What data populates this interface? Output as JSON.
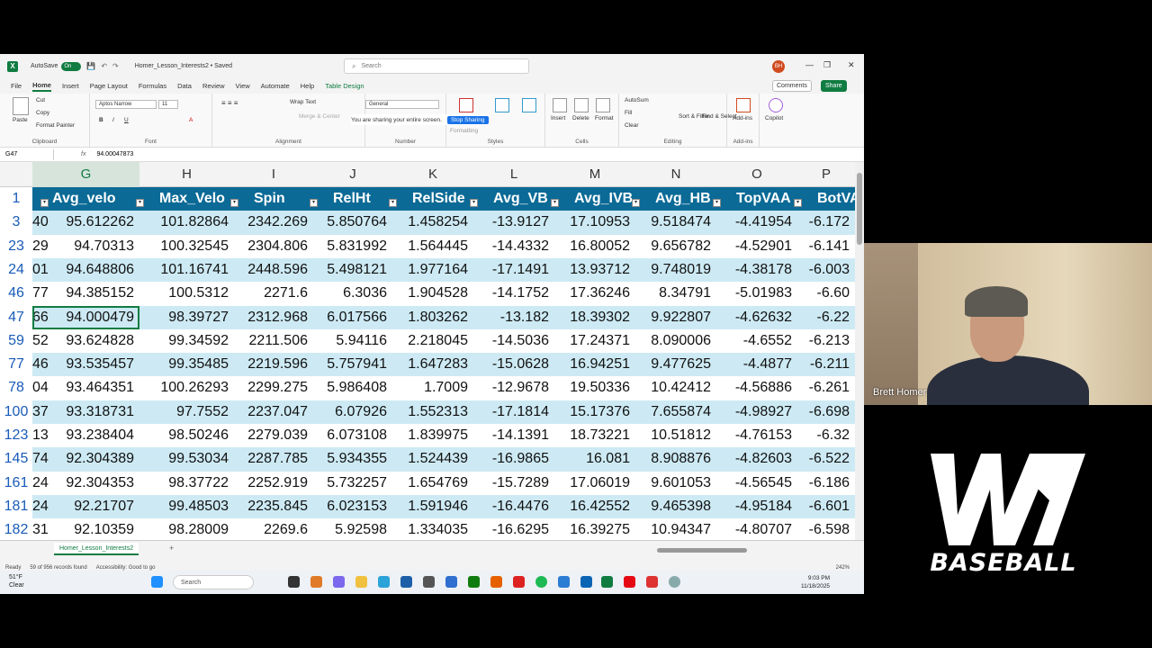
{
  "excel": {
    "autosave_label": "AutoSave",
    "autosave_state": "On",
    "doc_title": "Homer_Lesson_Interests2 • Saved",
    "search_placeholder": "Search",
    "avatar_initials": "BH",
    "tabs": [
      "File",
      "Home",
      "Insert",
      "Page Layout",
      "Formulas",
      "Data",
      "Review",
      "View",
      "Automate",
      "Help",
      "Table Design"
    ],
    "comments_label": "Comments",
    "share_label": "Share",
    "ribbon": {
      "paste": "Paste",
      "cut": "Cut",
      "copy": "Copy",
      "format_painter": "Format Painter",
      "clipboard": "Clipboard",
      "font_name": "Aptos Narrow",
      "font_size": "11",
      "font": "Font",
      "wrap_text": "Wrap Text",
      "merge_center": "Merge & Center",
      "alignment": "Alignment",
      "number_format": "General",
      "number": "Number",
      "sharing_text": "You are sharing your entire screen.",
      "stop_sharing": "Stop Sharing",
      "conditional_formatting": "Formatting",
      "styles": "Styles",
      "insert": "Insert",
      "delete": "Delete",
      "format": "Format",
      "cells": "Cells",
      "autosum": "AutoSum",
      "fill": "Fill",
      "clear": "Clear",
      "sort_filter": "Sort & Filter",
      "find_select": "Find & Select",
      "editing": "Editing",
      "addins": "Add-ins",
      "copilot": "Copilot"
    },
    "name_box": "G47",
    "fx": "fx",
    "formula_value": "94.00047873",
    "columns": [
      "G",
      "H",
      "I",
      "J",
      "K",
      "L",
      "M",
      "N",
      "O",
      "P"
    ],
    "header_row_number": "1",
    "headers": [
      "Avg_velo",
      "Max_Velo",
      "Spin",
      "RelHt",
      "RelSide",
      "Avg_VB",
      "Avg_IVB",
      "Avg_HB",
      "TopVAA",
      "BotVAA"
    ],
    "rows": [
      {
        "n": "3",
        "f": "40",
        "v": [
          "95.612262",
          "101.82864",
          "2342.269",
          "5.850764",
          "1.458254",
          "-13.9127",
          "17.10953",
          "9.518474",
          "-4.41954",
          "-6.172"
        ]
      },
      {
        "n": "23",
        "f": "29",
        "v": [
          "94.70313",
          "100.32545",
          "2304.806",
          "5.831992",
          "1.564445",
          "-14.4332",
          "16.80052",
          "9.656782",
          "-4.52901",
          "-6.141"
        ]
      },
      {
        "n": "24",
        "f": "01",
        "v": [
          "94.648806",
          "101.16741",
          "2448.596",
          "5.498121",
          "1.977164",
          "-17.1491",
          "13.93712",
          "9.748019",
          "-4.38178",
          "-6.003"
        ]
      },
      {
        "n": "46",
        "f": "77",
        "v": [
          "94.385152",
          "100.5312",
          "2271.6",
          "6.3036",
          "1.904528",
          "-14.1752",
          "17.36246",
          "8.34791",
          "-5.01983",
          "-6.60"
        ]
      },
      {
        "n": "47",
        "f": "66",
        "v": [
          "94.000479",
          "98.39727",
          "2312.968",
          "6.017566",
          "1.803262",
          "-13.182",
          "18.39302",
          "9.922807",
          "-4.62632",
          "-6.22"
        ]
      },
      {
        "n": "59",
        "f": "52",
        "v": [
          "93.624828",
          "99.34592",
          "2211.506",
          "5.94116",
          "2.218045",
          "-14.5036",
          "17.24371",
          "8.090006",
          "-4.6552",
          "-6.213"
        ]
      },
      {
        "n": "77",
        "f": "46",
        "v": [
          "93.535457",
          "99.35485",
          "2219.596",
          "5.757941",
          "1.647283",
          "-15.0628",
          "16.94251",
          "9.477625",
          "-4.4877",
          "-6.211"
        ]
      },
      {
        "n": "78",
        "f": "04",
        "v": [
          "93.464351",
          "100.26293",
          "2299.275",
          "5.986408",
          "1.7009",
          "-12.9678",
          "19.50336",
          "10.42412",
          "-4.56886",
          "-6.261"
        ]
      },
      {
        "n": "100",
        "f": "37",
        "v": [
          "93.318731",
          "97.7552",
          "2237.047",
          "6.07926",
          "1.552313",
          "-17.1814",
          "15.17376",
          "7.655874",
          "-4.98927",
          "-6.698"
        ]
      },
      {
        "n": "123",
        "f": "13",
        "v": [
          "93.238404",
          "98.50246",
          "2279.039",
          "6.073108",
          "1.839975",
          "-14.1391",
          "18.73221",
          "10.51812",
          "-4.76153",
          "-6.32"
        ]
      },
      {
        "n": "145",
        "f": "74",
        "v": [
          "92.304389",
          "99.53034",
          "2287.785",
          "5.934355",
          "1.524439",
          "-16.9865",
          "16.081",
          "8.908876",
          "-4.82603",
          "-6.522"
        ]
      },
      {
        "n": "161",
        "f": "24",
        "v": [
          "92.304353",
          "98.37722",
          "2252.919",
          "5.732257",
          "1.654769",
          "-15.7289",
          "17.06019",
          "9.601053",
          "-4.56545",
          "-6.186"
        ]
      },
      {
        "n": "181",
        "f": "24",
        "v": [
          "92.21707",
          "99.48503",
          "2235.845",
          "6.023153",
          "1.591946",
          "-16.4476",
          "16.42552",
          "9.465398",
          "-4.95184",
          "-6.601"
        ]
      },
      {
        "n": "182",
        "f": "31",
        "v": [
          "92.10359",
          "98.28009",
          "2269.6",
          "5.92598",
          "1.334035",
          "-16.6295",
          "16.39275",
          "10.94347",
          "-4.80707",
          "-6.598"
        ]
      }
    ],
    "sheet_tab": "Homer_Lesson_Interests2",
    "status_ready": "Ready",
    "status_records": "59 of 956 records found",
    "status_accessibility": "Accessibility: Good to go",
    "zoom": "242%"
  },
  "taskbar": {
    "temp": "51°F",
    "condition": "Clear",
    "search": "Search",
    "time": "9:03 PM",
    "date": "11/18/2025"
  },
  "webcam": {
    "name": "Brett Homer"
  },
  "logo": {
    "text": "BASEBALL"
  }
}
